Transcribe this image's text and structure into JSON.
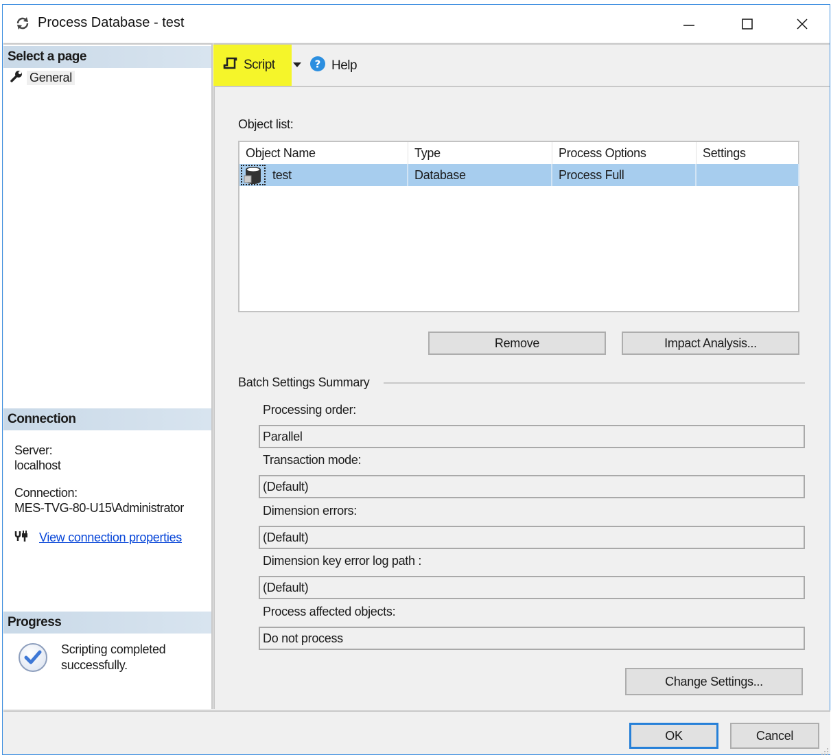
{
  "window": {
    "title": "Process Database - test",
    "icon": "refresh-icon",
    "controls": {
      "minimize": "minimize-icon",
      "maximize": "maximize-icon",
      "close": "close-icon"
    }
  },
  "sidebar": {
    "select_page_header": "Select a page",
    "pages": [
      {
        "label": "General",
        "icon": "wrench-icon"
      }
    ],
    "connection_header": "Connection",
    "server_label": "Server:",
    "server_value": "localhost",
    "connection_label": "Connection:",
    "connection_value": "MES-TVG-80-U15\\Administrator",
    "view_connection_link": "View connection properties",
    "progress_header": "Progress",
    "progress_status": "Scripting completed successfully.",
    "progress_line1": "Scripting completed",
    "progress_line2": "successfully."
  },
  "toolbar": {
    "script_label": "Script",
    "help_label": "Help",
    "highlight_color": "#f5f52a"
  },
  "main": {
    "object_list_label": "Object list:",
    "columns": [
      "Object Name",
      "Type",
      "Process Options",
      "Settings"
    ],
    "rows": [
      {
        "object_name": "test",
        "type": "Database",
        "process_options": "Process Full",
        "settings": "",
        "icon": "database-icon",
        "selected": true
      }
    ],
    "remove_button": "Remove",
    "impact_analysis_button": "Impact Analysis...",
    "batch_settings_title": "Batch Settings Summary",
    "fields": [
      {
        "label": "Processing order:",
        "value": "Parallel"
      },
      {
        "label": "Transaction mode:",
        "value": "(Default)"
      },
      {
        "label": "Dimension errors:",
        "value": "(Default)"
      },
      {
        "label": "Dimension key error log path :",
        "value": "(Default)"
      },
      {
        "label": "Process affected objects:",
        "value": "Do not process"
      }
    ],
    "change_settings_button": "Change Settings..."
  },
  "footer": {
    "ok_button": "OK",
    "cancel_button": "Cancel"
  },
  "colors": {
    "selection": "#a7cdee",
    "accent": "#2680d8",
    "link": "#0645d8"
  }
}
